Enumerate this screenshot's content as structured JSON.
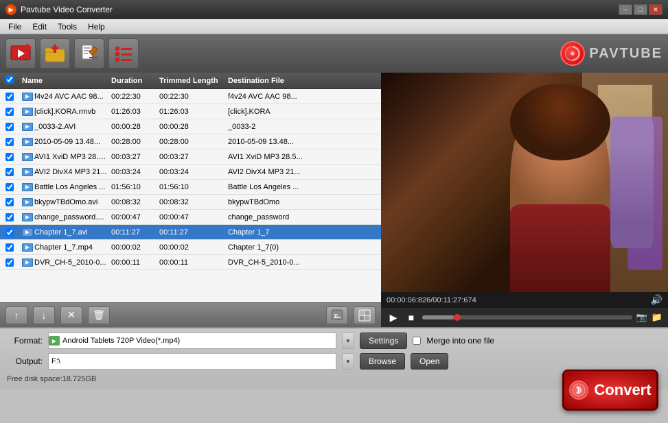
{
  "window": {
    "title": "Pavtube Video Converter",
    "controls": {
      "minimize": "─",
      "maximize": "□",
      "close": "✕"
    }
  },
  "menu": {
    "items": [
      "File",
      "Edit",
      "Tools",
      "Help"
    ]
  },
  "toolbar": {
    "buttons": [
      {
        "name": "add-video",
        "icon": "🎬+",
        "label": "Add Video"
      },
      {
        "name": "add-folder",
        "icon": "📁+",
        "label": "Add Folder"
      },
      {
        "name": "edit",
        "icon": "✏",
        "label": "Edit"
      },
      {
        "name": "list",
        "icon": "≡",
        "label": "List"
      }
    ],
    "logo_text": "PAVTUBE"
  },
  "file_list": {
    "columns": [
      "",
      "Name",
      "Duration",
      "Trimmed Length",
      "Destination File"
    ],
    "rows": [
      {
        "checked": true,
        "name": "f4v24 AVC AAC 98...",
        "duration": "00:22:30",
        "trimmed": "00:22:30",
        "dest": "f4v24 AVC AAC 98..."
      },
      {
        "checked": true,
        "name": "[click].KORA.rmvb",
        "duration": "01:26:03",
        "trimmed": "01:26:03",
        "dest": "[click].KORA"
      },
      {
        "checked": true,
        "name": "_0033-2.AVI",
        "duration": "00:00:28",
        "trimmed": "00:00:28",
        "dest": "_0033-2"
      },
      {
        "checked": true,
        "name": "2010-05-09 13.48...",
        "duration": "00:28:00",
        "trimmed": "00:28:00",
        "dest": "2010-05-09 13.48..."
      },
      {
        "checked": true,
        "name": "AVI1 XviD MP3 28.5...",
        "duration": "00:03:27",
        "trimmed": "00:03:27",
        "dest": "AVI1 XviD MP3 28.5..."
      },
      {
        "checked": true,
        "name": "AVI2 DivX4 MP3 21...",
        "duration": "00:03:24",
        "trimmed": "00:03:24",
        "dest": "AVI2 DivX4 MP3 21..."
      },
      {
        "checked": true,
        "name": "Battle Los Angeles ...",
        "duration": "01:56:10",
        "trimmed": "01:56:10",
        "dest": "Battle Los Angeles ..."
      },
      {
        "checked": true,
        "name": "bkypwTBdOmo.avi",
        "duration": "00:08:32",
        "trimmed": "00:08:32",
        "dest": "bkypwTBdOmo"
      },
      {
        "checked": true,
        "name": "change_password....",
        "duration": "00:00:47",
        "trimmed": "00:00:47",
        "dest": "change_password"
      },
      {
        "checked": true,
        "name": "Chapter 1_7.avi",
        "duration": "00:11:27",
        "trimmed": "00:11:27",
        "dest": "Chapter 1_7",
        "selected": true
      },
      {
        "checked": true,
        "name": "Chapter 1_7.mp4",
        "duration": "00:00:02",
        "trimmed": "00:00:02",
        "dest": "Chapter 1_7(0)"
      },
      {
        "checked": true,
        "name": "DVR_CH-5_2010-0...",
        "duration": "00:00:11",
        "trimmed": "00:00:11",
        "dest": "DVR_CH-5_2010-0..."
      }
    ]
  },
  "action_buttons": [
    {
      "name": "move-up",
      "icon": "↑",
      "label": "Move Up"
    },
    {
      "name": "move-down",
      "icon": "↓",
      "label": "Move Down"
    },
    {
      "name": "remove",
      "icon": "✕",
      "label": "Remove"
    },
    {
      "name": "delete",
      "icon": "🗑",
      "label": "Delete"
    },
    {
      "name": "info",
      "icon": "💬",
      "label": "Info"
    },
    {
      "name": "grid",
      "icon": "⊞",
      "label": "Grid"
    }
  ],
  "video_preview": {
    "time_current": "00:00:06:826",
    "time_total": "00:11:27:674",
    "time_display": "00:00:06:826/00:11:27:674"
  },
  "video_controls": {
    "play": "▶",
    "stop": "■",
    "camera": "📷",
    "folder": "📁"
  },
  "bottom": {
    "format_label": "Format:",
    "format_value": "Android Tablets 720P Video(*.mp4)",
    "settings_label": "Settings",
    "merge_label": "Merge into one file",
    "output_label": "Output:",
    "output_value": "F:\\",
    "browse_label": "Browse",
    "open_label": "Open",
    "disk_space": "Free disk space:18.725GB",
    "convert_label": "Convert"
  }
}
